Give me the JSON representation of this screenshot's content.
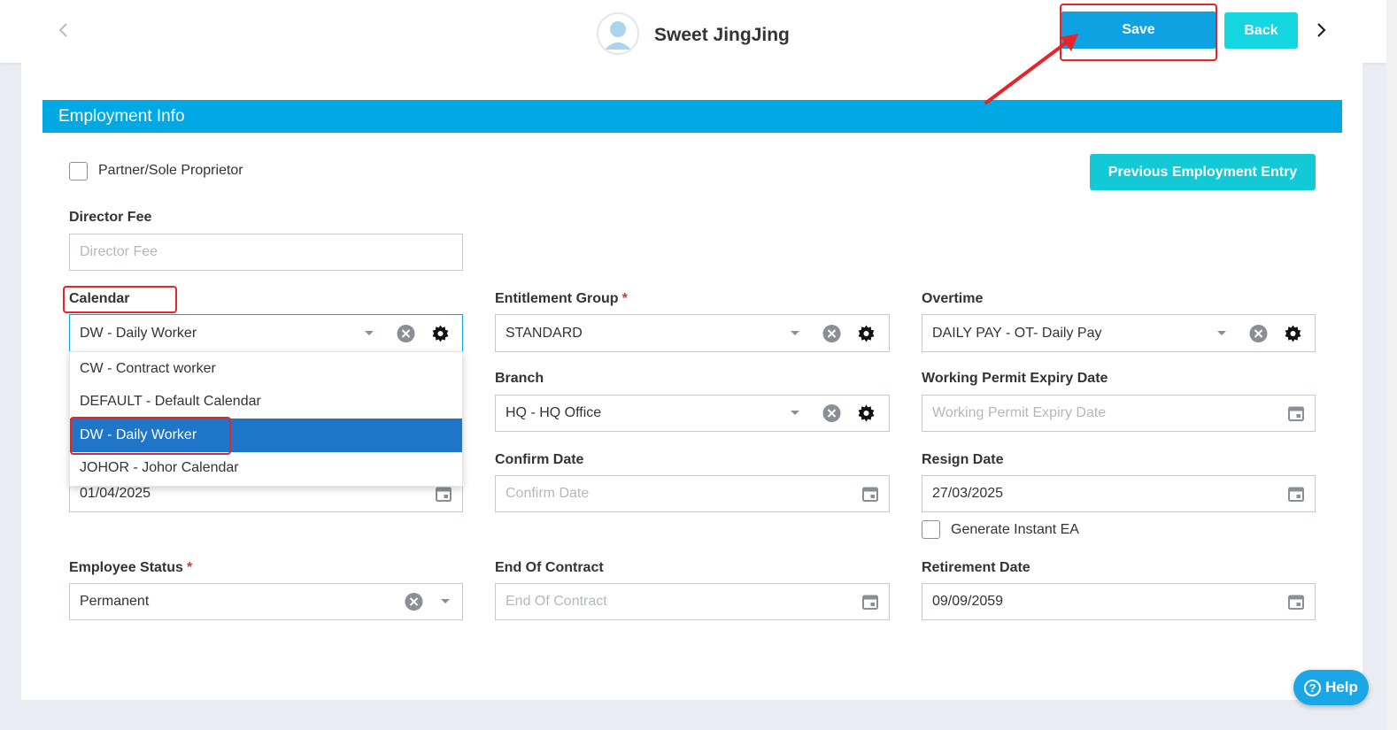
{
  "header": {
    "employee_name": "Sweet JingJing",
    "save_label": "Save",
    "back_label": "Back"
  },
  "section": {
    "title": "Employment Info"
  },
  "partner_checkbox": {
    "label": "Partner/Sole Proprietor",
    "checked": false
  },
  "previous_employment_label": "Previous Employment Entry",
  "director_fee": {
    "label": "Director Fee",
    "placeholder": "Director Fee",
    "value": ""
  },
  "calendar": {
    "label": "Calendar",
    "value": "DW - Daily Worker",
    "options": [
      "CW - Contract worker",
      "DEFAULT - Default Calendar",
      "DW - Daily Worker",
      "JOHOR - Johor Calendar"
    ],
    "selected_index": 2
  },
  "hidden_date_value": "01/04/2025",
  "entitlement_group": {
    "label": "Entitlement Group",
    "required_mark": "*",
    "value": "STANDARD"
  },
  "overtime": {
    "label": "Overtime",
    "value": "DAILY PAY - OT- Daily Pay"
  },
  "branch": {
    "label": "Branch",
    "value": "HQ - HQ Office"
  },
  "working_permit_expiry": {
    "label": "Working Permit Expiry Date",
    "placeholder": "Working Permit Expiry Date"
  },
  "confirm_date": {
    "label": "Confirm Date",
    "placeholder": "Confirm Date"
  },
  "resign_date": {
    "label": "Resign Date",
    "value": "27/03/2025"
  },
  "generate_instant_ea": {
    "label": "Generate Instant EA",
    "checked": false
  },
  "employee_status": {
    "label": "Employee Status",
    "required_mark": "*",
    "value": "Permanent"
  },
  "end_of_contract": {
    "label": "End Of Contract",
    "placeholder": "End Of Contract"
  },
  "retirement_date": {
    "label": "Retirement Date",
    "value": "09/09/2059"
  },
  "help_label": "Help",
  "colors": {
    "primary": "#0ea2e3",
    "section_bar": "#00a8e6",
    "teal_button": "#14d6e0",
    "selected_option": "#1f75c7",
    "annotation_red": "#e8242b"
  }
}
